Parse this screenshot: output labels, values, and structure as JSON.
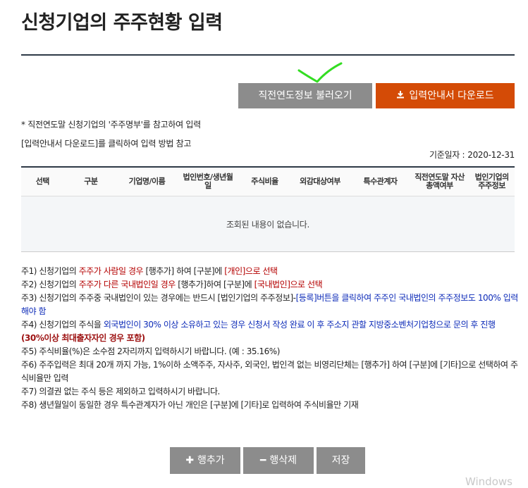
{
  "page": {
    "title": "신청기업의 주주현황 입력"
  },
  "buttons": {
    "load_prev": "직전연도정보 불러오기",
    "download_guide": "입력안내서 다운로드",
    "download_icon": "download-icon"
  },
  "notes_top": [
    "* 직전연도말 신청기업의 '주주명부'를 참고하여 입력",
    "[입력안내서 다운로드]를 클릭하여 입력 방법 참고"
  ],
  "base_date": {
    "label": "기준일자 :",
    "value": "2020-12-31"
  },
  "table": {
    "columns": [
      {
        "key": "select",
        "label": "선택"
      },
      {
        "key": "type",
        "label": "구분"
      },
      {
        "key": "name",
        "label": "기업명/이름"
      },
      {
        "key": "reg_no",
        "label": "법인번호/생년월일"
      },
      {
        "key": "ratio",
        "label": "주식비율"
      },
      {
        "key": "foreign",
        "label": "외감대상여부"
      },
      {
        "key": "related",
        "label": "특수관계자"
      },
      {
        "key": "assets",
        "label": "직전연도말 자산총액여부"
      },
      {
        "key": "corp_info",
        "label": "법인기업의 주주정보"
      }
    ],
    "empty_message": "조회된 내용이 없습니다."
  },
  "notes": {
    "n1": {
      "a": "주1) 신청기업의 ",
      "b": "주주가 사람일 경우",
      "c": " [행추가] 하여 [구분]에 ",
      "d": "[개인]",
      "e": "으로 선택"
    },
    "n2": {
      "a": "주2) 신청기업의 ",
      "b": "주주가 다른 국내법인일 경우",
      "c": " [행추가]하여 [구분]에 ",
      "d": "[국내법인]",
      "e": "으로 선택"
    },
    "n3": {
      "a": "주3) 신청기업의 주주중 국내법인이 있는 경우에는 반드시 [법인기업의 주주정보]-",
      "b": "[등록]버튼을 클릭하여 주주인 국내법인의 주주정보도 100% 입력해야 함"
    },
    "n4": {
      "a": "주4) 신청기업의 주식을 ",
      "b": "외국법인이 30% 이상 소유하고 있는 경우 신청서 작성 완료 이 후 주소지 관할 지방중소벤처기업청으로 문의 후 진행",
      "c": " (30%이상 최대출자자인 경우 포함)"
    },
    "n5": "주5) 주식비율(%)은 소수점 2자리까지 입력하시기 바랍니다. (예 : 35.16%)",
    "n6": "주6) 주주입력은 최대 20개 까지 가능, 1%이하 소액주주, 자사주, 외국인, 법인격 없는 비영리단체는 [행추가] 하여 [구분]에 [기타]으로 선택하여 주식비율만 입력",
    "n7": "주7) 의결권 없는 주식 등은 제외하고 입력하시기 바랍니다.",
    "n8": "주8) 생년월일이 동일한 경우 특수관계자가 아닌 개인은 [구분]에 [기타]로 입력하여 주식비율만 기재"
  },
  "bottom_buttons": {
    "add": "행추가",
    "delete": "행삭제",
    "save": "저장"
  },
  "watermark": "Windows",
  "colors": {
    "orange": "#d44b06",
    "gray": "#8c8c8c",
    "rule": "#2e3a47",
    "check": "#33dd22"
  }
}
